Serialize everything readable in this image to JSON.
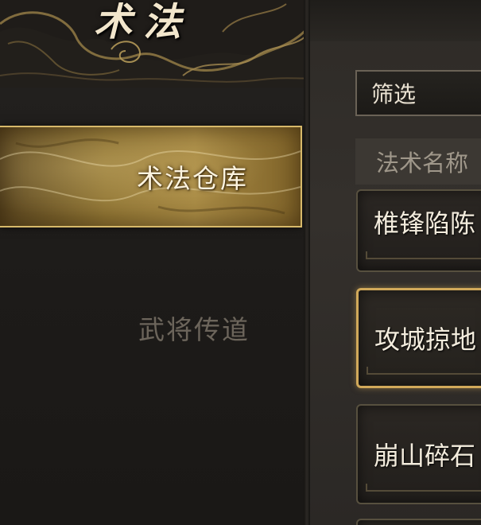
{
  "header": {
    "title": "术法"
  },
  "nav": {
    "items": [
      {
        "label": "术法仓库",
        "state": "active"
      },
      {
        "label": "武将传道",
        "state": "inactive"
      }
    ]
  },
  "filter": {
    "label": "筛选"
  },
  "table": {
    "column_header": "法术名称",
    "rows": [
      {
        "name": "椎锋陷陈",
        "selected": false
      },
      {
        "name": "攻城掠地",
        "selected": true
      },
      {
        "name": "崩山碎石",
        "selected": false
      }
    ]
  },
  "colors": {
    "accent_gold": "#d1a95a",
    "background": "#1e1c1a",
    "active_text": "#fbf3df",
    "inactive_text": "#6c655b"
  }
}
